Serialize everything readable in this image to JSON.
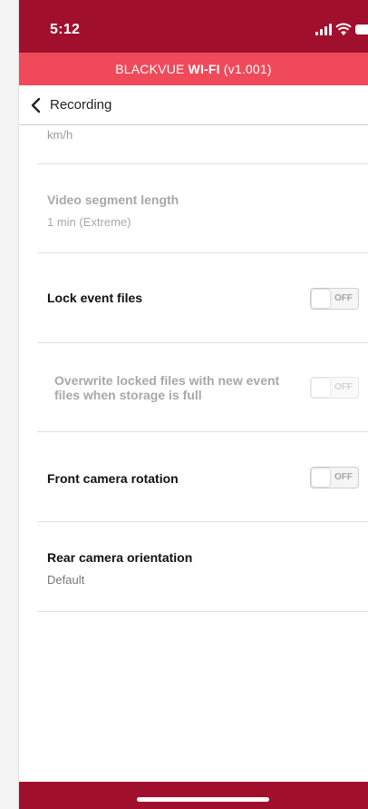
{
  "status_bar": {
    "time": "5:12"
  },
  "header": {
    "brand": "BLACKVUE",
    "wifi": "WI-FI",
    "version": "(v1.001)"
  },
  "nav": {
    "title": "Recording"
  },
  "settings": {
    "clipped_unit": "km/h",
    "video_segment": {
      "title": "Video segment length",
      "value": "1 min (Extreme)"
    },
    "lock_event": {
      "title": "Lock event files",
      "toggle": "OFF"
    },
    "overwrite_locked": {
      "title": "Overwrite locked files with new event files when storage is full",
      "toggle": "OFF"
    },
    "front_rotation": {
      "title": "Front camera rotation",
      "toggle": "OFF"
    },
    "rear_orientation": {
      "title": "Rear camera orientation",
      "value": "Default"
    }
  },
  "colors": {
    "status_bar": "#a0102c",
    "header": "#f04a5a",
    "bottom_bar": "#a0102c"
  }
}
